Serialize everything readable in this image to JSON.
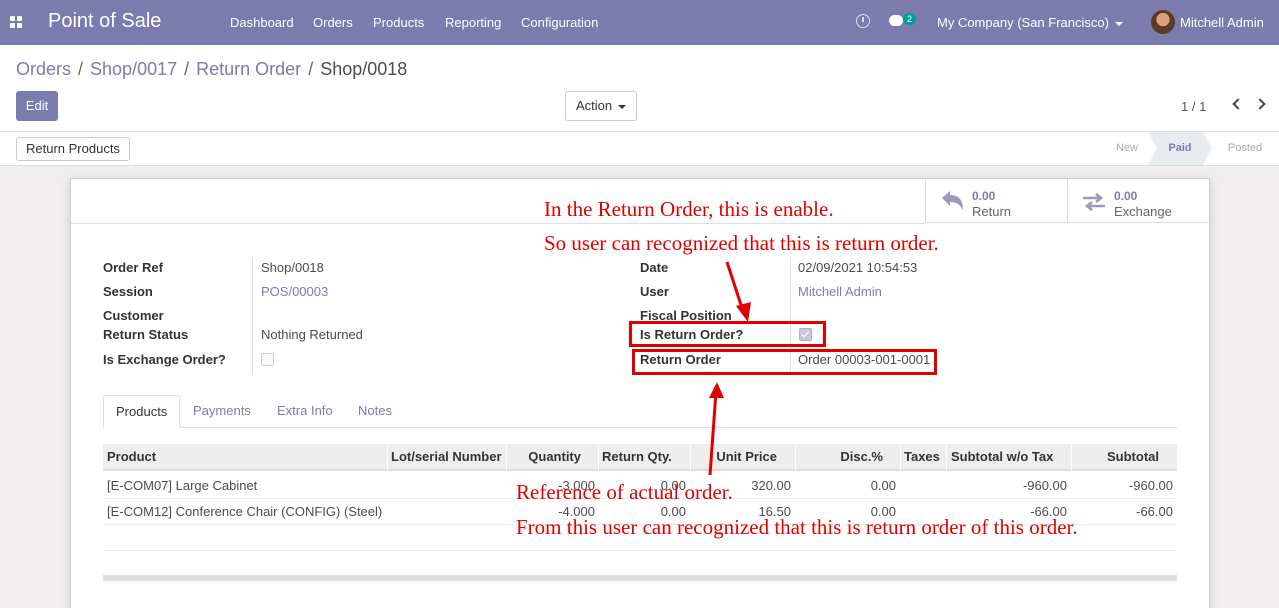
{
  "topbar": {
    "app_name": "Point of Sale",
    "menu": [
      "Dashboard",
      "Orders",
      "Products",
      "Reporting",
      "Configuration"
    ],
    "chat_count": "2",
    "company": "My Company (San Francisco)",
    "user": "Mitchell Admin"
  },
  "breadcrumb": [
    "Orders",
    "Shop/0017",
    "Return Order",
    "Shop/0018"
  ],
  "control": {
    "edit_label": "Edit",
    "action_label": "Action",
    "pager": "1 / 1"
  },
  "statusbar": {
    "return_products_label": "Return Products",
    "stages": [
      "New",
      "Paid",
      "Posted"
    ],
    "active_stage": "Paid"
  },
  "smart_buttons": {
    "return": {
      "value": "0.00",
      "label": "Return"
    },
    "exchange": {
      "value": "0.00",
      "label": "Exchange"
    }
  },
  "fields": {
    "order_ref": {
      "label": "Order Ref",
      "value": "Shop/0018"
    },
    "session": {
      "label": "Session",
      "value": "POS/00003"
    },
    "customer": {
      "label": "Customer",
      "value": ""
    },
    "return_status": {
      "label": "Return Status",
      "value": "Nothing Returned"
    },
    "is_exchange": {
      "label": "Is Exchange Order?",
      "checked": false
    },
    "date": {
      "label": "Date",
      "value": "02/09/2021 10:54:53"
    },
    "user": {
      "label": "User",
      "value": "Mitchell Admin"
    },
    "fiscal_position": {
      "label": "Fiscal Position",
      "value": ""
    },
    "is_return": {
      "label": "Is Return Order?",
      "checked": true
    },
    "return_order": {
      "label": "Return Order",
      "value": "Order 00003-001-0001"
    }
  },
  "tabs": [
    "Products",
    "Payments",
    "Extra Info",
    "Notes"
  ],
  "table": {
    "headers": [
      "Product",
      "Lot/serial Number",
      "Quantity",
      "Return Qty.",
      "Unit Price",
      "Disc.%",
      "Taxes",
      "Subtotal w/o Tax",
      "Subtotal"
    ],
    "rows": [
      [
        "[E-COM07] Large Cabinet",
        "",
        "-3.000",
        "0.00",
        "320.00",
        "0.00",
        "",
        "-960.00",
        "-960.00"
      ],
      [
        "[E-COM12] Conference Chair (CONFIG) (Steel)",
        "",
        "-4.000",
        "0.00",
        "16.50",
        "0.00",
        "",
        "-66.00",
        "-66.00"
      ]
    ]
  },
  "annotations": {
    "top_line1": "In the Return Order, this is enable.",
    "top_line2": "So user can recognized that this is return order.",
    "bottom_line1": "Reference of actual order.",
    "bottom_line2": "From this user can recognized that this is return order of this order."
  },
  "colors": {
    "brand": "#7c7bad",
    "annotation": "#e00000"
  }
}
